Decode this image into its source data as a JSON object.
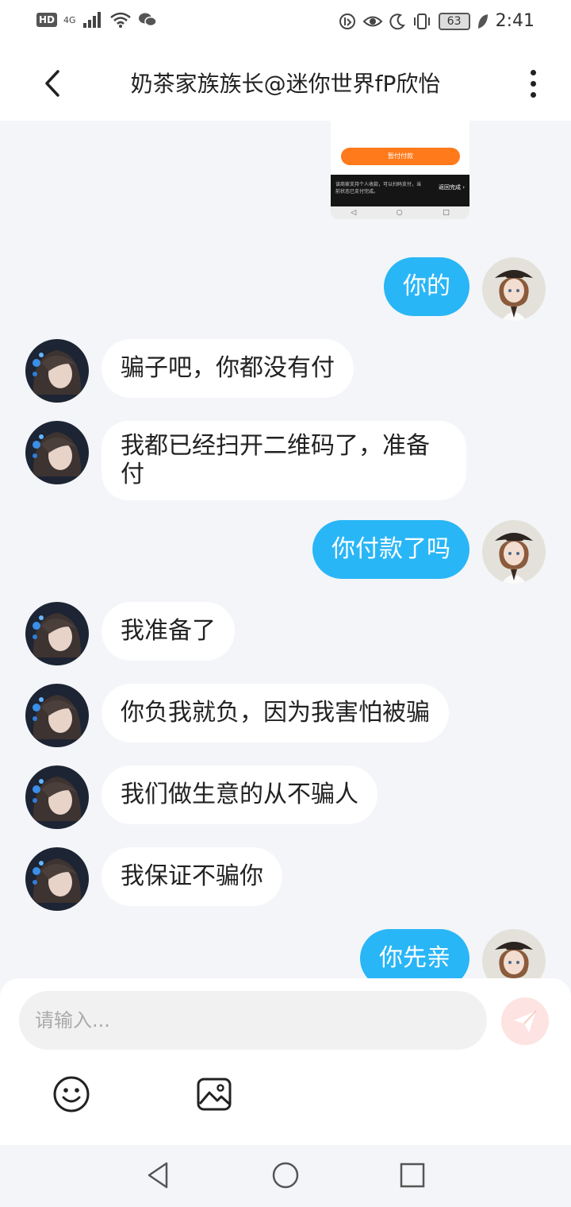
{
  "status_bar": {
    "hd_badge": "HD",
    "network": "4G",
    "battery": "63",
    "time": "2:41"
  },
  "header": {
    "title": "奶茶家族族长@迷你世界fP欣怡"
  },
  "screenshot_message": {
    "button_label": "暂付付款",
    "footer_text": "该商家支持个人收款，可以扫码支付，当前状态已支付完成。",
    "footer_action": "返回完成 ›"
  },
  "messages": [
    {
      "side": "out",
      "text": "你的"
    },
    {
      "side": "in",
      "text": "骗子吧，你都没有付"
    },
    {
      "side": "in",
      "text": "我都已经扫开二维码了，准备付"
    },
    {
      "side": "out",
      "text": "你付款了吗"
    },
    {
      "side": "in",
      "text": "我准备了"
    },
    {
      "side": "in",
      "text": "你负我就负，因为我害怕被骗"
    },
    {
      "side": "in",
      "text": "我们做生意的从不骗人"
    },
    {
      "side": "in",
      "text": "我保证不骗你"
    },
    {
      "side": "out",
      "text": "你先亲"
    }
  ],
  "composer": {
    "placeholder": "请输入..."
  },
  "colors": {
    "outgoing_bubble": "#29b6f6",
    "incoming_bubble": "#ffffff",
    "chat_background": "#f3f5f8",
    "send_button": "#fde3e1"
  }
}
